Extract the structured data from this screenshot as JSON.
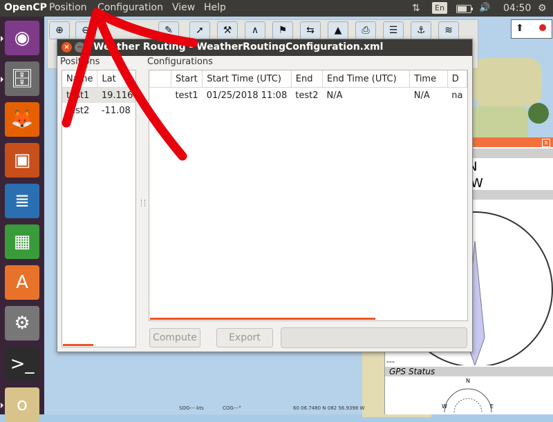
{
  "topbar": {
    "app_name": "OpenCP",
    "menus": [
      "Position",
      "Configuration",
      "View",
      "Help"
    ],
    "lang": "En",
    "time": "04:50",
    "icons": [
      "network-arrows-icon",
      "battery-icon",
      "volume-icon",
      "power-gear-icon"
    ],
    "battery_level": 0.7
  },
  "launcher": {
    "apps": [
      {
        "name": "ubuntu-dash-icon",
        "glyph": "◉",
        "color": "#7e3b8a"
      },
      {
        "name": "files-icon",
        "glyph": "🗄",
        "color": "#6b6b6b"
      },
      {
        "name": "firefox-icon",
        "glyph": "🦊",
        "color": "#e66000"
      },
      {
        "name": "impress-icon",
        "glyph": "▣",
        "color": "#c84f1b"
      },
      {
        "name": "writer-icon",
        "glyph": "≣",
        "color": "#2b6fb3"
      },
      {
        "name": "calc-icon",
        "glyph": "▦",
        "color": "#3a9b3a"
      },
      {
        "name": "software-center-icon",
        "glyph": "A",
        "color": "#e8722a"
      },
      {
        "name": "settings-icon",
        "glyph": "⚙",
        "color": "#777777"
      },
      {
        "name": "terminal-icon",
        "glyph": ">_",
        "color": "#2c2c2c"
      },
      {
        "name": "opencpn-icon",
        "glyph": "o",
        "color": "#d8c48a"
      }
    ]
  },
  "dialog": {
    "title": "Weather Routing - WeatherRoutingConfiguration.xml",
    "positions_label": "Positions",
    "configurations_label": "Configurations",
    "positions": {
      "columns": [
        "Name",
        "Lat"
      ],
      "rows": [
        [
          "test1",
          "19.116"
        ],
        [
          "test2",
          "-11.08"
        ]
      ]
    },
    "configs": {
      "columns": [
        "",
        "Start",
        "Start Time (UTC)",
        "End",
        "End Time (UTC)",
        "Time",
        "D"
      ],
      "rows": [
        [
          "",
          "test1",
          "01/25/2018 11:08",
          "test2",
          "N/A",
          "N/A",
          "na"
        ]
      ]
    },
    "compute_label": "Compute",
    "export_label": "Export"
  },
  "dashboard": {
    "heading_n": "N",
    "heading_w": "W",
    "dashes": "---",
    "gps_status": "GPS Status",
    "compass_n": "N",
    "compass_w": "W",
    "compass_e": "E"
  },
  "statusbar": {
    "sog": "SOG--- kts",
    "cog": "COG---°",
    "position": "60 06.7480 N  082 56.9398 W"
  },
  "annotation": {
    "color": "#e8000d"
  }
}
